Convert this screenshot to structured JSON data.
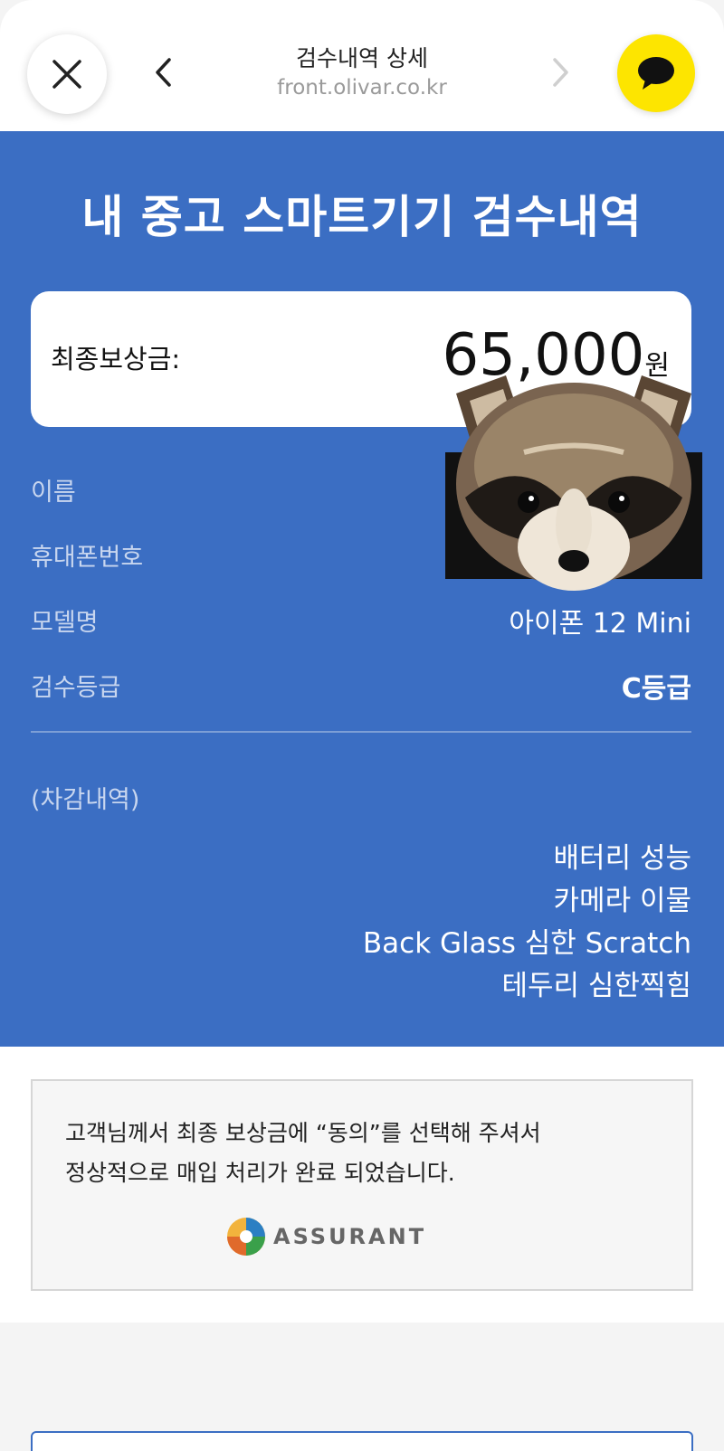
{
  "browser": {
    "title": "검수내역 상세",
    "url": "front.olivar.co.kr"
  },
  "hero": {
    "title": "내 중고 스마트기기 검수내역"
  },
  "amount": {
    "label": "최종보상금:",
    "value": "65,000",
    "unit": "원"
  },
  "info": [
    {
      "label": "이름",
      "value": ""
    },
    {
      "label": "휴대폰번호",
      "value": ""
    },
    {
      "label": "모델명",
      "value": "아이폰 12 Mini"
    },
    {
      "label": "검수등급",
      "value": "C등급"
    }
  ],
  "deductions": {
    "title": "(차감내역)",
    "items": [
      "배터리 성능",
      "카메라 이물",
      "Back Glass 심한 Scratch",
      "테두리 심한찍힘"
    ]
  },
  "notice": {
    "line1": "고객님께서 최종 보상금에 “동의”를 선택해 주셔서",
    "line2": "정상적으로 매입 처리가 완료 되었습니다.",
    "brand": "ASSURANT"
  },
  "colors": {
    "accent": "#3b6ec3",
    "chat": "#fde500"
  },
  "icons": {
    "close": "close-icon",
    "back": "chevron-left-icon",
    "forward": "chevron-right-icon",
    "chat": "chat-bubble-icon"
  }
}
